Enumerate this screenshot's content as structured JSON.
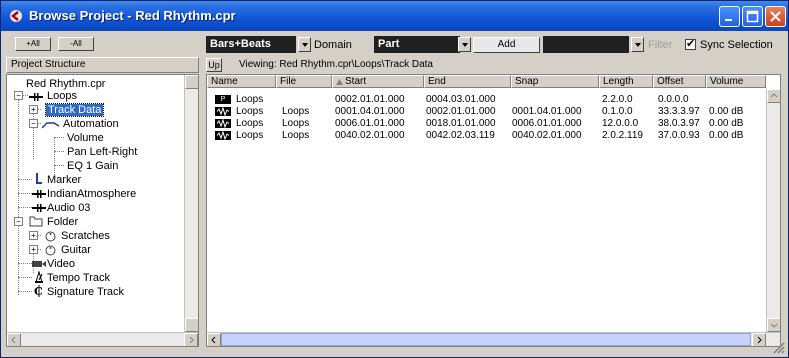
{
  "window": {
    "title": "Browse Project - Red Rhythm.cpr"
  },
  "toolbar": {
    "expand_all": "+All",
    "collapse_all": "-All",
    "display_format": "Bars+Beats",
    "domain_label": "Domain",
    "part_value": "Part",
    "add_label": "Add",
    "filter_value": "",
    "filter_label": "Filter",
    "sync_label": "Sync Selection",
    "sync_checked": true
  },
  "left_panel": {
    "header": "Project Structure",
    "tree": [
      {
        "label": "Red Rhythm.cpr",
        "icon": "project-icon"
      },
      {
        "label": "Loops",
        "icon": "audio-track-icon"
      },
      {
        "label": "Track Data",
        "icon": "track-data-icon",
        "selected": true
      },
      {
        "label": "Automation",
        "icon": "automation-icon"
      },
      {
        "label": "Volume",
        "icon": ""
      },
      {
        "label": "Pan Left-Right",
        "icon": ""
      },
      {
        "label": "EQ 1 Gain",
        "icon": ""
      },
      {
        "label": "Marker",
        "icon": "marker-icon"
      },
      {
        "label": "IndianAtmosphere",
        "icon": "audio-track-icon"
      },
      {
        "label": "Audio 03",
        "icon": "audio-track-icon"
      },
      {
        "label": "Folder",
        "icon": "folder-icon"
      },
      {
        "label": "Scratches",
        "icon": "midi-track-icon"
      },
      {
        "label": "Guitar",
        "icon": "midi-track-icon"
      },
      {
        "label": "Video",
        "icon": "video-icon"
      },
      {
        "label": "Tempo Track",
        "icon": "tempo-icon"
      },
      {
        "label": "Signature Track",
        "icon": "signature-icon"
      }
    ]
  },
  "right_panel": {
    "up_label": "Up",
    "viewing_text": "Viewing: Red Rhythm.cpr\\Loops\\Track Data",
    "columns": [
      "Name",
      "File",
      "Start",
      "End",
      "Snap",
      "Length",
      "Offset",
      "Volume"
    ],
    "rows": [
      {
        "icon": "part-icon",
        "icon_text": "P",
        "name": "Loops",
        "file": "",
        "start": "0002.01.01.000",
        "end": "0004.03.01.000",
        "snap": "",
        "length": "2.2.0.0",
        "offset": "0.0.0.0",
        "volume": ""
      },
      {
        "icon": "event-icon",
        "icon_text": "",
        "name": "Loops",
        "file": "Loops",
        "start": "0001.04.01.000",
        "end": "0002.01.01.000",
        "snap": "0001.04.01.000",
        "length": "0.1.0.0",
        "offset": "33.3.3.97",
        "volume": "0.00 dB"
      },
      {
        "icon": "event-icon",
        "icon_text": "",
        "name": "Loops",
        "file": "Loops",
        "start": "0006.01.01.000",
        "end": "0018.01.01.000",
        "snap": "0006.01.01.000",
        "length": "12.0.0.0",
        "offset": "38.0.3.97",
        "volume": "0.00 dB"
      },
      {
        "icon": "event-icon",
        "icon_text": "",
        "name": "Loops",
        "file": "Loops",
        "start": "0040.02.01.000",
        "end": "0042.02.03.119",
        "snap": "0040.02.01.000",
        "length": "2.0.2.119",
        "offset": "37.0.0.93",
        "volume": "0.00 dB"
      }
    ]
  },
  "colors": {
    "titlebar": "#0f55d6",
    "selection": "#316ac5",
    "field_dark": "#202020"
  }
}
